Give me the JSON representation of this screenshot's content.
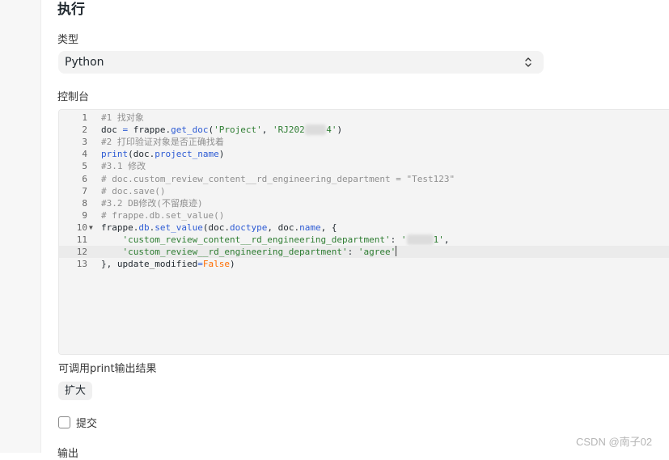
{
  "section": {
    "title": "执行"
  },
  "type_field": {
    "label": "类型",
    "value": "Python"
  },
  "console": {
    "label": "控制台",
    "lines": [
      {
        "num": "1",
        "active": false,
        "fold": false,
        "tokens": [
          {
            "t": "#1 找对象",
            "c": "comment"
          }
        ]
      },
      {
        "num": "2",
        "active": false,
        "fold": false,
        "tokens": [
          {
            "t": "doc "
          },
          {
            "t": "=",
            "c": "fn"
          },
          {
            "t": " frappe."
          },
          {
            "t": "get_doc",
            "c": "fn"
          },
          {
            "t": "("
          },
          {
            "t": "'Project'",
            "c": "str"
          },
          {
            "t": ", "
          },
          {
            "t": "'RJ202",
            "c": "str"
          },
          {
            "t": "0000",
            "c": "blur"
          },
          {
            "t": "4'",
            "c": "str"
          },
          {
            "t": ")"
          }
        ]
      },
      {
        "num": "3",
        "active": false,
        "fold": false,
        "tokens": [
          {
            "t": "#2 打印验证对象是否正确找着",
            "c": "comment"
          }
        ]
      },
      {
        "num": "4",
        "active": false,
        "fold": false,
        "tokens": [
          {
            "t": "print",
            "c": "fn"
          },
          {
            "t": "(doc."
          },
          {
            "t": "project_name",
            "c": "fn"
          },
          {
            "t": ")"
          }
        ]
      },
      {
        "num": "5",
        "active": false,
        "fold": false,
        "tokens": [
          {
            "t": "#3.1 修改",
            "c": "comment"
          }
        ]
      },
      {
        "num": "6",
        "active": false,
        "fold": false,
        "tokens": [
          {
            "t": "# doc.custom_review_content__rd_engineering_department = \"Test123\"",
            "c": "comment"
          }
        ]
      },
      {
        "num": "7",
        "active": false,
        "fold": false,
        "tokens": [
          {
            "t": "# doc.save()",
            "c": "comment"
          }
        ]
      },
      {
        "num": "8",
        "active": false,
        "fold": false,
        "tokens": [
          {
            "t": "#3.2 DB修改(不留痕迹)",
            "c": "comment"
          }
        ]
      },
      {
        "num": "9",
        "active": false,
        "fold": false,
        "tokens": [
          {
            "t": "# frappe.db.set_value()",
            "c": "comment"
          }
        ]
      },
      {
        "num": "10",
        "active": false,
        "fold": true,
        "tokens": [
          {
            "t": "frappe."
          },
          {
            "t": "db",
            "c": "fn"
          },
          {
            "t": "."
          },
          {
            "t": "set_value",
            "c": "fn"
          },
          {
            "t": "(doc."
          },
          {
            "t": "doctype",
            "c": "fn"
          },
          {
            "t": ", doc."
          },
          {
            "t": "name",
            "c": "fn"
          },
          {
            "t": ", {"
          }
        ]
      },
      {
        "num": "11",
        "active": false,
        "fold": false,
        "tokens": [
          {
            "t": "    "
          },
          {
            "t": "'custom_review_content__rd_engineering_department'",
            "c": "str"
          },
          {
            "t": ": "
          },
          {
            "t": "'",
            "c": "str"
          },
          {
            "t": "00000",
            "c": "blur"
          },
          {
            "t": "1'",
            "c": "str"
          },
          {
            "t": ","
          }
        ]
      },
      {
        "num": "12",
        "active": true,
        "fold": false,
        "tokens": [
          {
            "t": "    "
          },
          {
            "t": "'custom_review__rd_engineering_department'",
            "c": "str"
          },
          {
            "t": ": "
          },
          {
            "t": "'agree'",
            "c": "str"
          }
        ]
      },
      {
        "num": "13",
        "active": false,
        "fold": false,
        "tokens": [
          {
            "t": "}, update_modified"
          },
          {
            "t": "=",
            "c": "fn"
          },
          {
            "t": "False",
            "c": "kw"
          },
          {
            "t": ")"
          }
        ]
      }
    ]
  },
  "help": {
    "text": "可调用print输出结果"
  },
  "expand_button": {
    "label": "扩大"
  },
  "submit_checkbox": {
    "label": "提交",
    "checked": false
  },
  "output_field": {
    "label": "输出"
  },
  "watermark": {
    "text": "CSDN @南子02"
  },
  "icons": {
    "select": "chevron-up-down-icon",
    "fold": "fold-arrow-icon"
  }
}
